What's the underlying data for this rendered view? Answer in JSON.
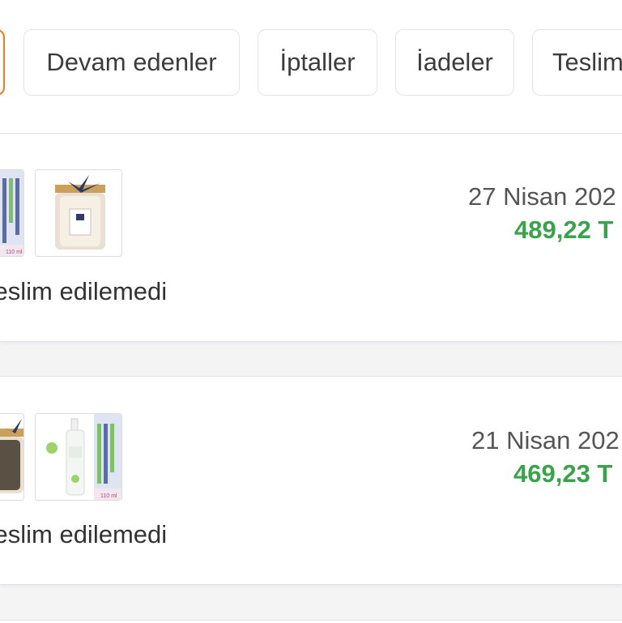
{
  "tabs": [
    {
      "label": "",
      "active": true
    },
    {
      "label": "Devam edenler",
      "active": false
    },
    {
      "label": "İptaller",
      "active": false
    },
    {
      "label": "İadeler",
      "active": false
    },
    {
      "label": "Teslim",
      "active": false
    }
  ],
  "orders": [
    {
      "date": "27 Nisan 202",
      "price": "489,22 T",
      "status": "Teslim edilemedi",
      "products": [
        {
          "name": "oil-bottle-label",
          "label": "110 ml"
        },
        {
          "name": "candle-jar",
          "label": ""
        }
      ]
    },
    {
      "date": "21 Nisan 202",
      "price": "469,23 T",
      "status": "Teslim edilemedi",
      "products": [
        {
          "name": "candle-jar",
          "label": ""
        },
        {
          "name": "spray-bottle-with-oil-box",
          "label": "110 ml"
        }
      ]
    }
  ],
  "colors": {
    "accent": "#f27a1a",
    "price": "#3aa24a",
    "background": "#f4f4f5"
  }
}
